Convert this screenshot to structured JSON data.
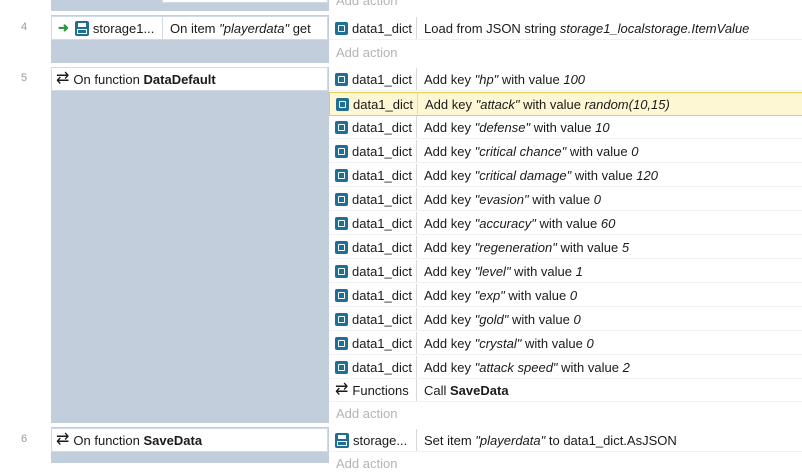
{
  "add_action_label": "Add action",
  "rows": [
    {
      "number": "4"
    },
    {
      "number": "5"
    },
    {
      "number": "6"
    }
  ],
  "event4": {
    "object": "storage1...",
    "condition_prefix": "On item ",
    "condition_item": "\"playerdata\"",
    "condition_suffix": " get",
    "action_object": "data1_dict",
    "action_prefix": "Load from JSON string ",
    "action_value": "storage1_localstorage.ItemValue"
  },
  "event5": {
    "condition_prefix": "On function ",
    "function_name": "DataDefault",
    "actions": [
      {
        "object": "data1_dict",
        "prefix": "Add key ",
        "key": "\"hp\"",
        "mid": " with value ",
        "value": "100"
      },
      {
        "object": "data1_dict",
        "prefix": "Add key ",
        "key": "\"attack\"",
        "mid": " with value ",
        "value": "random(10,15)"
      },
      {
        "object": "data1_dict",
        "prefix": "Add key ",
        "key": "\"defense\"",
        "mid": " with value ",
        "value": "10"
      },
      {
        "object": "data1_dict",
        "prefix": "Add key ",
        "key": "\"critical chance\"",
        "mid": " with value ",
        "value": "0"
      },
      {
        "object": "data1_dict",
        "prefix": "Add key ",
        "key": "\"critical damage\"",
        "mid": " with value ",
        "value": "120"
      },
      {
        "object": "data1_dict",
        "prefix": "Add key ",
        "key": "\"evasion\"",
        "mid": " with value ",
        "value": "0"
      },
      {
        "object": "data1_dict",
        "prefix": "Add key ",
        "key": "\"accuracy\"",
        "mid": " with value ",
        "value": "60"
      },
      {
        "object": "data1_dict",
        "prefix": "Add key ",
        "key": "\"regeneration\"",
        "mid": " with value ",
        "value": "5"
      },
      {
        "object": "data1_dict",
        "prefix": "Add key ",
        "key": "\"level\"",
        "mid": " with value ",
        "value": "1"
      },
      {
        "object": "data1_dict",
        "prefix": "Add key ",
        "key": "\"exp\"",
        "mid": " with value ",
        "value": "0"
      },
      {
        "object": "data1_dict",
        "prefix": "Add key ",
        "key": "\"gold\"",
        "mid": " with value ",
        "value": "0"
      },
      {
        "object": "data1_dict",
        "prefix": "Add key ",
        "key": "\"crystal\"",
        "mid": " with value ",
        "value": "0"
      },
      {
        "object": "data1_dict",
        "prefix": "Add key ",
        "key": "\"attack speed\"",
        "mid": " with value ",
        "value": "2"
      }
    ],
    "call_object": "Functions",
    "call_prefix": "Call ",
    "call_name": "SaveData"
  },
  "event6": {
    "condition_prefix": "On function ",
    "function_name": "SaveData",
    "action_object": "storage...",
    "action_prefix": "Set item ",
    "action_item": "\"playerdata\"",
    "action_suffix": " to data1_dict.AsJSON"
  }
}
